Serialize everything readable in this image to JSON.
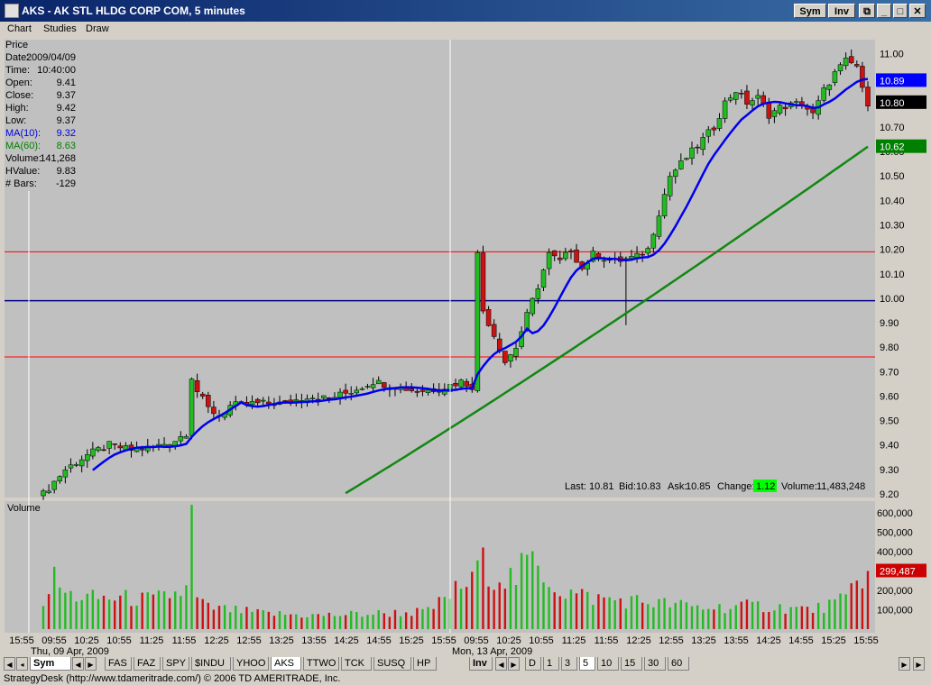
{
  "window": {
    "title": "AKS - AK STL HLDG CORP COM, 5 minutes",
    "buttons": [
      "Sym",
      "Inv"
    ]
  },
  "menu": [
    "Chart",
    "Studies",
    "Draw"
  ],
  "info_panel": [
    {
      "label": "Price",
      "value": "",
      "color": "#000000"
    },
    {
      "label": "Date:",
      "value": "2009/04/09",
      "color": "#000000"
    },
    {
      "label": "Time:",
      "value": "10:40:00",
      "color": "#000000"
    },
    {
      "label": "Open:",
      "value": "9.41",
      "color": "#000000"
    },
    {
      "label": "Close:",
      "value": "9.37",
      "color": "#000000"
    },
    {
      "label": "High:",
      "value": "9.42",
      "color": "#000000"
    },
    {
      "label": "Low:",
      "value": "9.37",
      "color": "#000000"
    },
    {
      "label": "MA(10):",
      "value": "9.32",
      "color": "#0000dd"
    },
    {
      "label": "MA(60):",
      "value": "8.63",
      "color": "#008000"
    },
    {
      "label": "Volume:",
      "value": "141,268",
      "color": "#000000"
    },
    {
      "label": "HValue:",
      "value": "9.83",
      "color": "#000000"
    },
    {
      "label": "# Bars:",
      "value": "-129",
      "color": "#000000"
    }
  ],
  "quote_bar": {
    "last_label": "Last:",
    "last": "10.81",
    "bid_label": "Bid:",
    "bid": "10.83",
    "ask_label": "Ask:",
    "ask": "10.85",
    "change_label": "Change:",
    "change": "1.12",
    "volume_label": "Volume:",
    "volume": "11,483,248"
  },
  "volume_panel": {
    "label": "Volume",
    "current_value": "299,487"
  },
  "price_badges": [
    {
      "value": 10.89,
      "text": "10.89",
      "bg": "#0000ff",
      "fg": "#ffffff"
    },
    {
      "value": 10.8,
      "text": "10.80",
      "bg": "#000000",
      "fg": "#ffffff"
    },
    {
      "value": 10.62,
      "text": "10.62",
      "bg": "#008000",
      "fg": "#ffffff"
    }
  ],
  "colors": {
    "up": "#22bb22",
    "down": "#cc1111",
    "ma10": "#0000ee",
    "ma60": "#118811",
    "hline_red": "#ff0000",
    "hline_blue": "#000088",
    "chart_bg": "#c0c0c0"
  },
  "chart_data": {
    "type": "candlestick",
    "price_axis": {
      "ylim": [
        9.2,
        11.05
      ],
      "ticks": [
        "11.00",
        "10.90",
        "10.80",
        "10.70",
        "10.60",
        "10.50",
        "10.40",
        "10.30",
        "10.20",
        "10.10",
        "10.00",
        "9.90",
        "9.80",
        "9.70",
        "9.60",
        "9.50",
        "9.40",
        "9.30",
        "9.20"
      ]
    },
    "volume_axis": {
      "ylim": [
        0,
        650000
      ],
      "ticks": [
        "600,000",
        "500,000",
        "400,000",
        "300,000",
        "200,000",
        "100,000"
      ]
    },
    "horizontal_lines": [
      {
        "value": 10.19,
        "color": "red"
      },
      {
        "value": 9.99,
        "color": "blue"
      },
      {
        "value": 9.76,
        "color": "red"
      }
    ],
    "x_tick_labels": [
      "15:55",
      "09:55",
      "10:25",
      "10:55",
      "11:25",
      "11:55",
      "12:25",
      "12:55",
      "13:25",
      "13:55",
      "14:25",
      "14:55",
      "15:25",
      "15:55",
      "09:55",
      "10:25",
      "10:55",
      "11:25",
      "11:55",
      "12:25",
      "12:55",
      "13:25",
      "13:55",
      "14:25",
      "14:55",
      "15:25",
      "15:55"
    ],
    "date_labels": [
      "Thu, 09 Apr, 2009",
      "Mon, 13 Apr, 2009"
    ],
    "close_waypoints": [
      [
        0,
        9.2
      ],
      [
        2,
        9.25
      ],
      [
        4,
        9.3
      ],
      [
        6,
        9.33
      ],
      [
        8,
        9.36
      ],
      [
        12,
        9.4
      ],
      [
        16,
        9.38
      ],
      [
        20,
        9.39
      ],
      [
        24,
        9.42
      ],
      [
        26,
        9.45
      ],
      [
        27,
        9.68
      ],
      [
        28,
        9.62
      ],
      [
        30,
        9.55
      ],
      [
        32,
        9.52
      ],
      [
        34,
        9.56
      ],
      [
        38,
        9.57
      ],
      [
        44,
        9.57
      ],
      [
        48,
        9.6
      ],
      [
        52,
        9.59
      ],
      [
        56,
        9.62
      ],
      [
        60,
        9.66
      ],
      [
        64,
        9.64
      ],
      [
        68,
        9.62
      ],
      [
        72,
        9.63
      ],
      [
        76,
        9.66
      ],
      [
        78,
        9.64
      ],
      [
        79,
        10.18
      ],
      [
        80,
        9.95
      ],
      [
        82,
        9.85
      ],
      [
        84,
        9.74
      ],
      [
        86,
        9.8
      ],
      [
        88,
        9.93
      ],
      [
        90,
        10.05
      ],
      [
        92,
        10.18
      ],
      [
        94,
        10.15
      ],
      [
        96,
        10.2
      ],
      [
        98,
        10.12
      ],
      [
        100,
        10.18
      ],
      [
        104,
        10.15
      ],
      [
        108,
        10.17
      ],
      [
        110,
        10.2
      ],
      [
        112,
        10.35
      ],
      [
        114,
        10.5
      ],
      [
        116,
        10.55
      ],
      [
        118,
        10.6
      ],
      [
        120,
        10.65
      ],
      [
        122,
        10.7
      ],
      [
        124,
        10.8
      ],
      [
        126,
        10.85
      ],
      [
        128,
        10.8
      ],
      [
        130,
        10.82
      ],
      [
        132,
        10.75
      ],
      [
        134,
        10.78
      ],
      [
        138,
        10.8
      ],
      [
        140,
        10.75
      ],
      [
        142,
        10.85
      ],
      [
        144,
        10.92
      ],
      [
        146,
        10.97
      ],
      [
        148,
        10.95
      ],
      [
        149,
        10.85
      ],
      [
        150,
        10.8
      ]
    ],
    "volume_waypoints": [
      [
        0,
        150000
      ],
      [
        2,
        260000
      ],
      [
        4,
        180000
      ],
      [
        8,
        160000
      ],
      [
        14,
        160000
      ],
      [
        20,
        150000
      ],
      [
        26,
        200000
      ],
      [
        27,
        640000
      ],
      [
        28,
        150000
      ],
      [
        30,
        110000
      ],
      [
        40,
        80000
      ],
      [
        50,
        70000
      ],
      [
        60,
        80000
      ],
      [
        70,
        90000
      ],
      [
        76,
        220000
      ],
      [
        78,
        240000
      ],
      [
        79,
        360000
      ],
      [
        82,
        280000
      ],
      [
        86,
        260000
      ],
      [
        88,
        350000
      ],
      [
        90,
        320000
      ],
      [
        94,
        200000
      ],
      [
        100,
        160000
      ],
      [
        110,
        140000
      ],
      [
        120,
        110000
      ],
      [
        130,
        120000
      ],
      [
        140,
        100000
      ],
      [
        146,
        150000
      ],
      [
        148,
        260000
      ],
      [
        150,
        299487
      ]
    ],
    "ma10_last": 10.89,
    "ma60_last": 10.62
  }
}
